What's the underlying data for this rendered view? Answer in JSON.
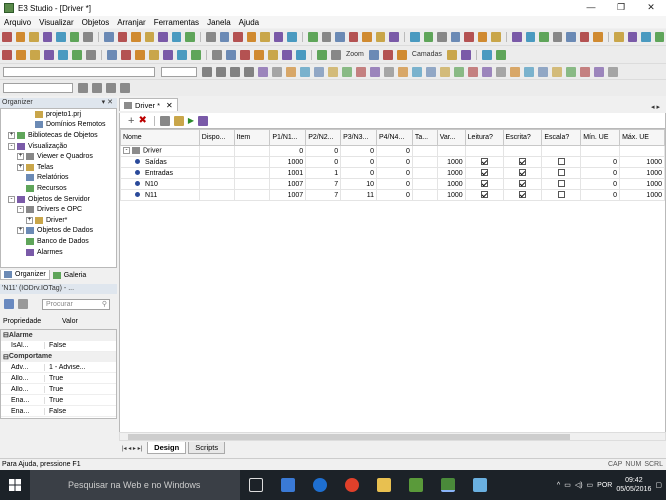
{
  "window": {
    "title": "E3 Studio - [Driver *]",
    "buttons": [
      "—",
      "❐",
      "✕"
    ]
  },
  "menu": [
    "Arquivo",
    "Visualizar",
    "Objetos",
    "Arranjar",
    "Ferramentas",
    "Janela",
    "Ajuda"
  ],
  "toolbar": {
    "zoom_label": "Zoom",
    "cameras_label": "Camadas"
  },
  "organizer": {
    "title": "Organizer",
    "tree": [
      {
        "label": "projeto1.prj",
        "indent": 3,
        "exp": ""
      },
      {
        "label": "Domínios Remotos",
        "indent": 3,
        "exp": ""
      },
      {
        "label": "Bibliotecas de Objetos",
        "indent": 1,
        "exp": "+"
      },
      {
        "label": "Visualização",
        "indent": 1,
        "exp": "-"
      },
      {
        "label": "Viewer e Quadros",
        "indent": 2,
        "exp": "+"
      },
      {
        "label": "Telas",
        "indent": 2,
        "exp": "+"
      },
      {
        "label": "Relatórios",
        "indent": 2,
        "exp": ""
      },
      {
        "label": "Recursos",
        "indent": 2,
        "exp": ""
      },
      {
        "label": "Objetos de Servidor",
        "indent": 1,
        "exp": "-"
      },
      {
        "label": "Drivers e OPC",
        "indent": 2,
        "exp": "-"
      },
      {
        "label": "Driver*",
        "indent": 3,
        "exp": "+"
      },
      {
        "label": "Objetos de Dados",
        "indent": 2,
        "exp": "+"
      },
      {
        "label": "Banco de Dados",
        "indent": 2,
        "exp": ""
      },
      {
        "label": "Alarmes",
        "indent": 2,
        "exp": ""
      }
    ],
    "tabs": [
      "Organizer",
      "Galeria"
    ]
  },
  "properties": {
    "title": "'N11' (IODrv.IOTag) - ...",
    "search_placeholder": "Procurar",
    "col_name": "Propriedade",
    "col_value": "Valor",
    "rows": [
      {
        "type": "cat",
        "name": "Alarme"
      },
      {
        "type": "prop",
        "name": "IsAl...",
        "value": "False"
      },
      {
        "type": "cat",
        "name": "Comportame"
      },
      {
        "type": "prop",
        "name": "Adv...",
        "value": "1 - Advise..."
      },
      {
        "type": "prop",
        "name": "Allo...",
        "value": "True"
      },
      {
        "type": "prop",
        "name": "Allo...",
        "value": "True"
      },
      {
        "type": "prop",
        "name": "Ena...",
        "value": "True"
      },
      {
        "type": "prop",
        "name": "Ena...",
        "value": "False"
      }
    ]
  },
  "editor": {
    "tab_label": "Driver *",
    "columns": [
      "Nome",
      "Dispo...",
      "Item",
      "P1/N1...",
      "P2/N2...",
      "P3/N3...",
      "P4/N4...",
      "Ta...",
      "Var...",
      "Leitura?",
      "Escrita?",
      "Escala?",
      "Mín. UE",
      "Máx. UE"
    ],
    "rows": [
      {
        "name": "Driver",
        "level": 0,
        "values": [
          "",
          "",
          "0",
          "0",
          "0",
          "0",
          "",
          "",
          null,
          null,
          null,
          "",
          ""
        ]
      },
      {
        "name": "Saídas",
        "level": 1,
        "values": [
          "",
          "",
          "1000",
          "0",
          "0",
          "0",
          "",
          "1000",
          true,
          true,
          false,
          "0",
          "1000"
        ]
      },
      {
        "name": "Entradas",
        "level": 1,
        "values": [
          "",
          "",
          "1001",
          "1",
          "0",
          "0",
          "",
          "1000",
          true,
          true,
          false,
          "0",
          "1000"
        ]
      },
      {
        "name": "N10",
        "level": 1,
        "values": [
          "",
          "",
          "1007",
          "7",
          "10",
          "0",
          "",
          "1000",
          true,
          true,
          false,
          "0",
          "1000"
        ]
      },
      {
        "name": "N11",
        "level": 1,
        "values": [
          "",
          "",
          "1007",
          "7",
          "11",
          "0",
          "",
          "1000",
          true,
          true,
          false,
          "0",
          "1000"
        ]
      }
    ],
    "bottom_tabs": [
      "Design",
      "Scripts"
    ]
  },
  "status": {
    "text": "Para Ajuda, pressione F1",
    "indicators": [
      "CAP",
      "NUM",
      "SCRL"
    ]
  },
  "taskbar": {
    "search_placeholder": "Pesquisar na Web e no Windows",
    "lang": "POR",
    "time": "09:42",
    "date": "05/05/2016"
  }
}
